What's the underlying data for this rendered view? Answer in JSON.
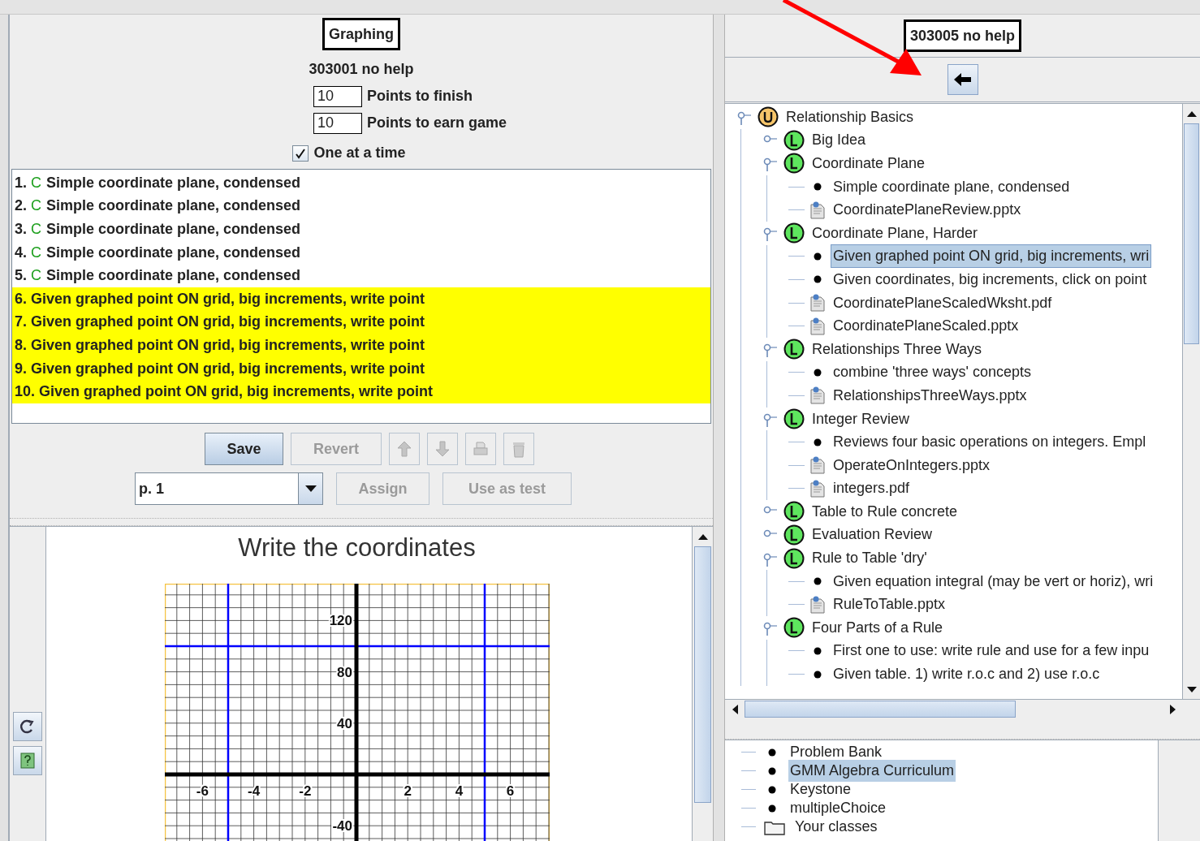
{
  "left_panel": {
    "title": "Graphing",
    "subtitle": "303001 no help",
    "fields": [
      {
        "value": "10",
        "label": "Points to finish"
      },
      {
        "value": "10",
        "label": "Points to earn game"
      }
    ],
    "one_at_a_time": {
      "label": "One at a time",
      "checked": true
    },
    "problems": [
      {
        "number": "1.",
        "mark": "C",
        "text": "Simple coordinate plane, condensed",
        "highlighted": false
      },
      {
        "number": "2.",
        "mark": "C",
        "text": "Simple coordinate plane, condensed",
        "highlighted": false
      },
      {
        "number": "3.",
        "mark": "C",
        "text": "Simple coordinate plane, condensed",
        "highlighted": false
      },
      {
        "number": "4.",
        "mark": "C",
        "text": "Simple coordinate plane, condensed",
        "highlighted": false
      },
      {
        "number": "5.",
        "mark": "C",
        "text": "Simple coordinate plane, condensed",
        "highlighted": false
      },
      {
        "number": "6.",
        "text": "Given graphed point ON grid, big increments, write point",
        "highlighted": true
      },
      {
        "number": "7.",
        "text": "Given graphed point ON grid, big increments, write point",
        "highlighted": true
      },
      {
        "number": "8.",
        "text": "Given graphed point ON grid, big increments, write point",
        "highlighted": true
      },
      {
        "number": "9.",
        "text": "Given graphed point ON grid, big increments, write point",
        "highlighted": true
      },
      {
        "number": "10.",
        "text": "Given graphed point ON grid, big increments, write point",
        "highlighted": true
      }
    ],
    "save_button": {
      "label": "Save",
      "disabled": false
    },
    "revert_button": {
      "label": "Revert",
      "disabled": true
    },
    "page_select": {
      "value": "p. 1"
    },
    "assign_button": {
      "label": "Assign",
      "disabled": true
    },
    "use_as_test_button": {
      "label": "Use as test",
      "disabled": true
    },
    "graph": {
      "title": "Write the coordinates",
      "x_ticks": [
        "-6",
        "-4",
        "-2",
        "2",
        "4",
        "6"
      ],
      "y_ticks": [
        "120",
        "80",
        "40",
        "-40"
      ]
    }
  },
  "right_panel": {
    "title": "303005 no help",
    "tree": [
      {
        "kind": "unit",
        "label": "Relationship Basics",
        "expanded": true,
        "selected": false,
        "children": [
          {
            "kind": "lesson",
            "label": "Big Idea",
            "expanded": false,
            "selected": false
          },
          {
            "kind": "lesson",
            "label": "Coordinate Plane",
            "expanded": true,
            "selected": false,
            "children": [
              {
                "kind": "problem",
                "label": "Simple coordinate plane, condensed",
                "selected": false
              },
              {
                "kind": "file",
                "label": "CoordinatePlaneReview.pptx",
                "selected": false
              }
            ]
          },
          {
            "kind": "lesson",
            "label": "Coordinate Plane, Harder",
            "expanded": true,
            "selected": false,
            "children": [
              {
                "kind": "problem",
                "label": "Given graphed point ON grid, big increments, wri",
                "selected": true
              },
              {
                "kind": "problem",
                "label": "Given coordinates, big increments, click on point",
                "selected": false
              },
              {
                "kind": "file",
                "label": "CoordinatePlaneScaledWksht.pdf",
                "selected": false
              },
              {
                "kind": "file",
                "label": "CoordinatePlaneScaled.pptx",
                "selected": false
              }
            ]
          },
          {
            "kind": "lesson",
            "label": "Relationships Three Ways",
            "expanded": true,
            "selected": false,
            "children": [
              {
                "kind": "problem",
                "label": "combine 'three ways' concepts",
                "selected": false
              },
              {
                "kind": "file",
                "label": "RelationshipsThreeWays.pptx",
                "selected": false
              }
            ]
          },
          {
            "kind": "lesson",
            "label": "Integer Review",
            "expanded": true,
            "selected": false,
            "children": [
              {
                "kind": "problem",
                "label": "Reviews four basic operations on integers. Empl",
                "selected": false
              },
              {
                "kind": "file",
                "label": "OperateOnIntegers.pptx",
                "selected": false
              },
              {
                "kind": "file",
                "label": "integers.pdf",
                "selected": false
              }
            ]
          },
          {
            "kind": "lesson",
            "label": "Table to Rule concrete",
            "expanded": false,
            "selected": false
          },
          {
            "kind": "lesson",
            "label": "Evaluation Review",
            "expanded": false,
            "selected": false
          },
          {
            "kind": "lesson",
            "label": "Rule to Table 'dry'",
            "expanded": true,
            "selected": false,
            "children": [
              {
                "kind": "problem",
                "label": "Given equation integral (may be vert or horiz), wri",
                "selected": false
              },
              {
                "kind": "file",
                "label": "RuleToTable.pptx",
                "selected": false
              }
            ]
          },
          {
            "kind": "lesson",
            "label": "Four Parts of a Rule",
            "expanded": true,
            "selected": false,
            "children": [
              {
                "kind": "problem",
                "label": "First one to use: write rule and use for a few inpu",
                "selected": false
              },
              {
                "kind": "problem",
                "label": "Given table. 1) write r.o.c and 2) use r.o.c",
                "selected": false
              }
            ]
          }
        ]
      }
    ],
    "bank_tree": [
      {
        "kind": "problem",
        "label": "Problem Bank",
        "selected": false
      },
      {
        "kind": "problem",
        "label": "GMM Algebra Curriculum",
        "selected": true
      },
      {
        "kind": "problem",
        "label": "Keystone",
        "selected": false
      },
      {
        "kind": "problem",
        "label": "multipleChoice",
        "selected": false
      },
      {
        "kind": "folder",
        "label": "Your classes",
        "selected": false
      }
    ]
  }
}
